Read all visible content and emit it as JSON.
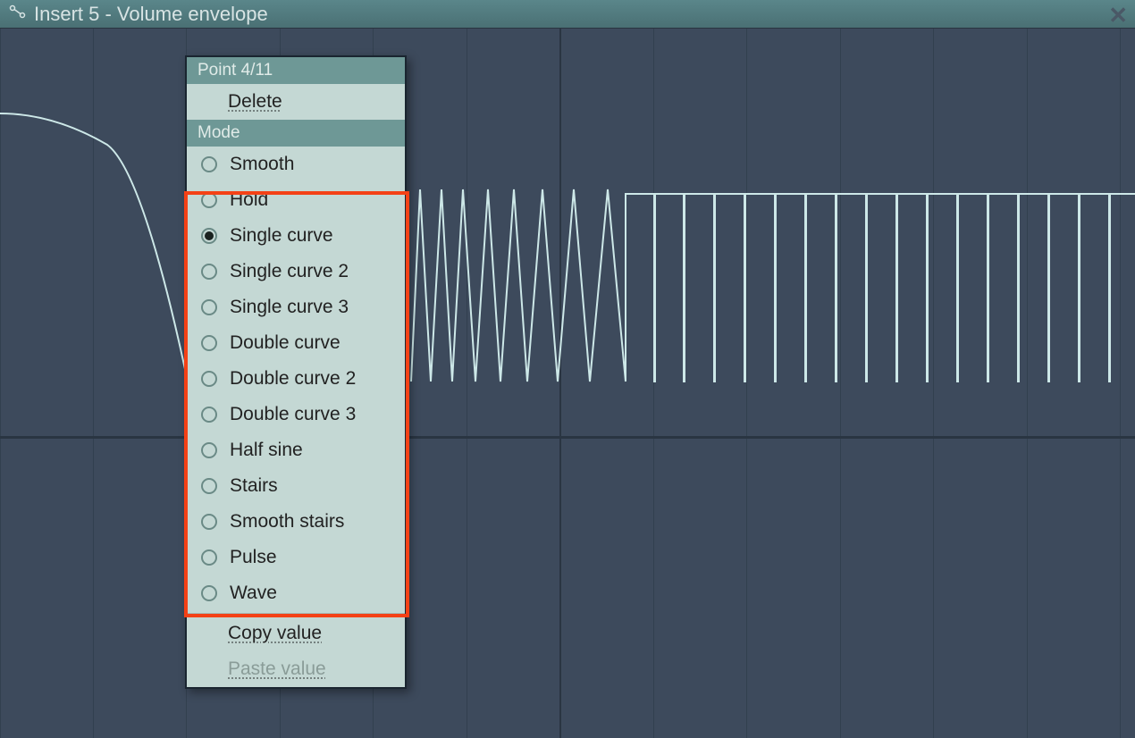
{
  "titlebar": {
    "title": "Insert 5 - Volume envelope"
  },
  "menu": {
    "header1": "Point 4/11",
    "delete": "Delete",
    "header2": "Mode",
    "modes": [
      {
        "label": "Smooth",
        "selected": false
      },
      {
        "label": "Hold",
        "selected": false
      },
      {
        "label": "Single curve",
        "selected": true
      },
      {
        "label": "Single curve 2",
        "selected": false
      },
      {
        "label": "Single curve 3",
        "selected": false
      },
      {
        "label": "Double curve",
        "selected": false
      },
      {
        "label": "Double curve 2",
        "selected": false
      },
      {
        "label": "Double curve 3",
        "selected": false
      },
      {
        "label": "Half sine",
        "selected": false
      },
      {
        "label": "Stairs",
        "selected": false
      },
      {
        "label": "Smooth stairs",
        "selected": false
      },
      {
        "label": "Pulse",
        "selected": false
      },
      {
        "label": "Wave",
        "selected": false
      }
    ],
    "copy": "Copy value",
    "paste": "Paste value"
  }
}
